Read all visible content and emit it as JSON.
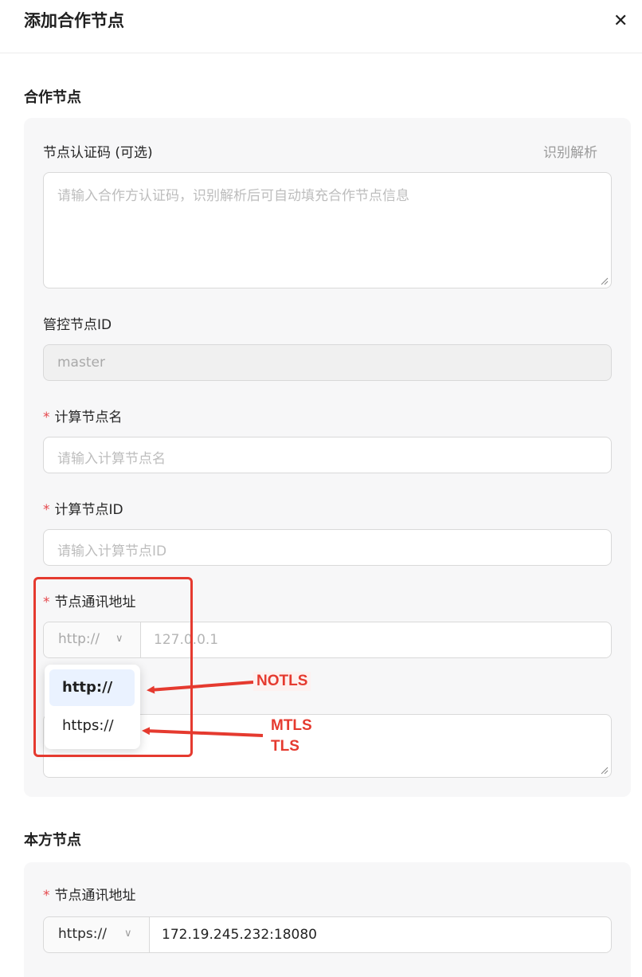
{
  "dialog": {
    "title": "添加合作节点",
    "close_glyph": "✕"
  },
  "partner_section": {
    "title": "合作节点",
    "auth_code": {
      "label": "节点认证码 (可选)",
      "action": "识别解析",
      "placeholder": "请输入合作方认证码，识别解析后可自动填充合作节点信息"
    },
    "control_node": {
      "label": "管控节点ID",
      "value": "master"
    },
    "compute_name": {
      "required_mark": "*",
      "label": "计算节点名",
      "placeholder": "请输入计算节点名"
    },
    "compute_id": {
      "required_mark": "*",
      "label": "计算节点ID",
      "placeholder": "请输入计算节点ID"
    },
    "comm_address": {
      "required_mark": "*",
      "label": "节点通讯地址",
      "protocol": "http://",
      "chevron": "∨",
      "value": "127.0.0.1",
      "options": [
        "http://",
        "https://"
      ],
      "selected_index": 0
    }
  },
  "annotations": {
    "notls": "NOTLS",
    "mtls": "MTLS",
    "tls": "TLS",
    "color": "#e53a2f"
  },
  "local_section": {
    "title": "本方节点",
    "comm_address": {
      "required_mark": "*",
      "label": "节点通讯地址",
      "protocol": "https://",
      "chevron": "∨",
      "value": "172.19.245.232:18080"
    }
  }
}
